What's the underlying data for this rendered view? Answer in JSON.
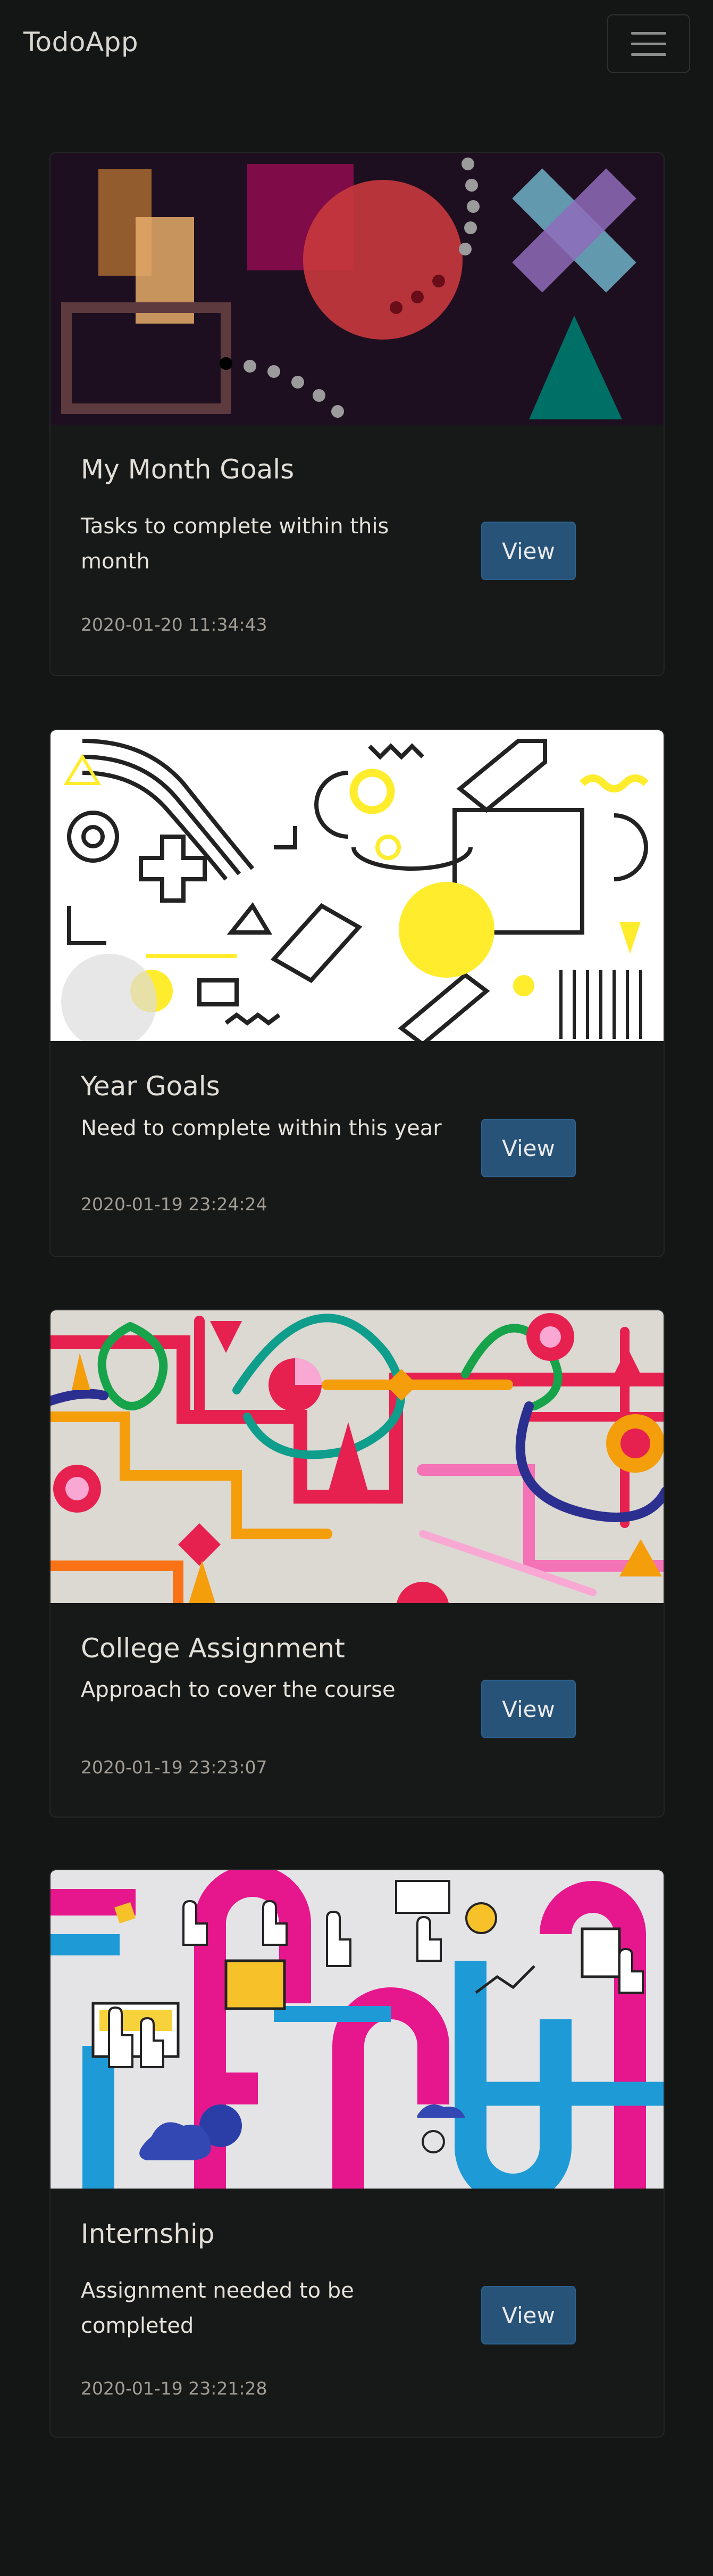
{
  "navbar": {
    "brand": "TodoApp",
    "menu_icon": "hamburger-menu-icon"
  },
  "cards": [
    {
      "title": "My Month Goals",
      "description": "Tasks to complete within this month",
      "button_label": "View",
      "date": "2020-01-20 11:34:43",
      "image": "abstract-geometric-shapes-dark"
    },
    {
      "title": "Year Goals",
      "description": "Need to complete within this year",
      "button_label": "View",
      "date": "2020-01-19 23:24:24",
      "image": "black-white-yellow-geometric-pattern"
    },
    {
      "title": "College Assignment",
      "description": "Approach to cover the course",
      "button_label": "View",
      "date": "2020-01-19 23:23:07",
      "image": "colorful-pipes-abstract"
    },
    {
      "title": "Internship",
      "description": "Assignment needed to be completed",
      "button_label": "View",
      "date": "2020-01-19 23:21:28",
      "image": "hands-and-pipes-illustration"
    }
  ],
  "colors": {
    "background": "#141616",
    "card_background": "#171918",
    "button": "#275379",
    "date_text": "#a29e96"
  }
}
